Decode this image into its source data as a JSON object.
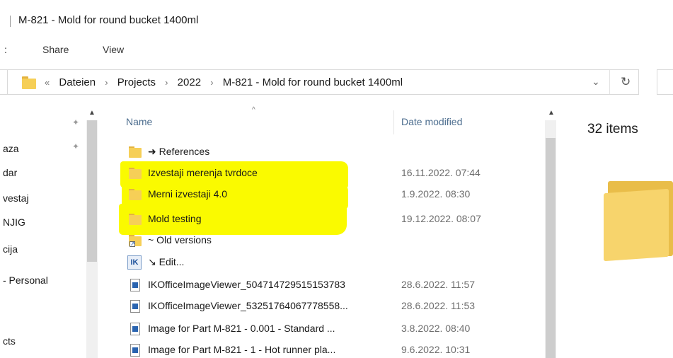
{
  "window": {
    "title": "M-821 - Mold for round bucket 1400ml"
  },
  "ribbon": {
    "left_fragment": ":",
    "tabs": [
      "Share",
      "View"
    ]
  },
  "address": {
    "overflow": "«",
    "crumbs": [
      "Dateien",
      "Projects",
      "2022",
      "M-821 - Mold for round bucket 1400ml"
    ],
    "dropdown": "⌄",
    "refresh": "↻"
  },
  "nav": {
    "items": [
      "aza",
      "dar",
      "vestaj",
      "NJIG",
      "cija",
      "- Personal",
      "cts"
    ]
  },
  "columns": {
    "name": "Name",
    "date_modified": "Date modified"
  },
  "files": [
    {
      "name": "➜ References",
      "date": "",
      "icon": "folder-icon"
    },
    {
      "name": "Izvestaji merenja tvrdoce",
      "date": "16.11.2022. 07:44",
      "icon": "folder-icon"
    },
    {
      "name": "Merni izvestaji 4.0",
      "date": "1.9.2022. 08:30",
      "icon": "folder-icon"
    },
    {
      "name": "Mold testing",
      "date": "19.12.2022. 08:07",
      "icon": "folder-icon"
    },
    {
      "name": "~ Old versions",
      "date": "",
      "icon": "folder-shortcut-icon"
    },
    {
      "name": "↘ Edit...",
      "date": "",
      "icon": "k-app-icon"
    },
    {
      "name": "IKOfficeImageViewer_504714729515153783",
      "date": "28.6.2022. 11:57",
      "icon": "image-file-icon"
    },
    {
      "name": "IKOfficeImageViewer_53251764067778558...",
      "date": "28.6.2022. 11:53",
      "icon": "image-file-icon"
    },
    {
      "name": "Image for Part M-821 - 0.001 - Standard ...",
      "date": "3.8.2022. 08:40",
      "icon": "image-file-icon"
    },
    {
      "name": "Image for Part M-821 - 1 - Hot runner pla...",
      "date": "9.6.2022. 10:31",
      "icon": "image-file-icon"
    }
  ],
  "details": {
    "count": "32 items"
  },
  "colors": {
    "highlight": "#fafa00",
    "folder": "#f6cf57",
    "header_text": "#4d6e8f"
  }
}
